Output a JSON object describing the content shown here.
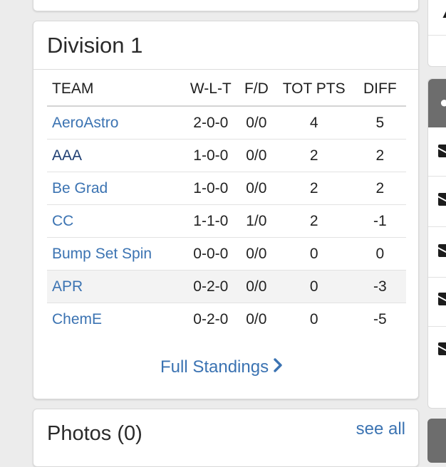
{
  "division": {
    "title": "Division 1",
    "columns": [
      "TEAM",
      "W-L-T",
      "F/D",
      "TOT PTS",
      "DIFF"
    ],
    "rows": [
      {
        "team": "AeroAstro",
        "wlt": "2-0-0",
        "fd": "0/0",
        "pts": "4",
        "diff": "5"
      },
      {
        "team": "AAA",
        "wlt": "1-0-0",
        "fd": "0/0",
        "pts": "2",
        "diff": "2"
      },
      {
        "team": "Be Grad",
        "wlt": "1-0-0",
        "fd": "0/0",
        "pts": "2",
        "diff": "2"
      },
      {
        "team": "CC",
        "wlt": "1-1-0",
        "fd": "1/0",
        "pts": "2",
        "diff": "-1"
      },
      {
        "team": "Bump Set Spin",
        "wlt": "0-0-0",
        "fd": "0/0",
        "pts": "0",
        "diff": "0"
      },
      {
        "team": "APR",
        "wlt": "0-2-0",
        "fd": "0/0",
        "pts": "0",
        "diff": "-3"
      },
      {
        "team": "ChemE",
        "wlt": "0-2-0",
        "fd": "0/0",
        "pts": "0",
        "diff": "-5"
      }
    ],
    "full_standings_label": "Full Standings",
    "chevron_icon": "chevron-right-icon"
  },
  "photos": {
    "title": "Photos (0)",
    "see_all_label": "see all"
  },
  "colors": {
    "link": "#3b73b2",
    "link_dark": "#1f3f73",
    "sidebar_header": "#6d6d6d",
    "highlight_row": "#f3f3f3"
  },
  "sidebar": {
    "icons": [
      "envelope-icon",
      "envelope-icon",
      "envelope-icon",
      "envelope-icon",
      "envelope-icon"
    ]
  }
}
